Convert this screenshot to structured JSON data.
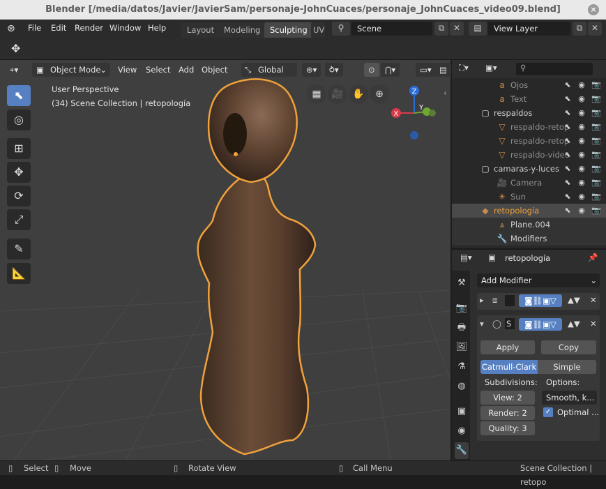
{
  "window": {
    "title": "Blender [/media/datos/Javier/JavierSam/personaje-JohnCuaces/personaje_JohnCuaces_video09.blend]",
    "close_glyph": "×"
  },
  "menubar": {
    "items": [
      "File",
      "Edit",
      "Render",
      "Window",
      "Help"
    ],
    "workspaces": [
      "Layout",
      "Modeling",
      "Sculpting",
      "UV"
    ],
    "active_workspace": "Sculpting",
    "scene": "Scene",
    "view_layer": "View Layer"
  },
  "viewport_header": {
    "mode": "Object Mode",
    "menus": [
      "View",
      "Select",
      "Add",
      "Object"
    ],
    "orientation": "Global"
  },
  "viewport": {
    "perspective": "User Perspective",
    "collection_info": "(34) Scene Collection | retopología",
    "gizmo": {
      "x": "X",
      "y": "Y",
      "z": "Z"
    }
  },
  "outliner": {
    "rows": [
      {
        "label": "Ojos",
        "icon": "font-icon",
        "level": 3,
        "dim": true
      },
      {
        "label": "Text",
        "icon": "font-icon",
        "level": 3,
        "dim": true
      },
      {
        "label": "respaldos",
        "icon": "collection-icon",
        "level": 2,
        "dim": false
      },
      {
        "label": "respaldo-retop",
        "icon": "mesh-cone-icon",
        "level": 3,
        "dim": true
      },
      {
        "label": "respaldo-retop",
        "icon": "mesh-cone-icon",
        "level": 3,
        "dim": true
      },
      {
        "label": "respaldo-video",
        "icon": "mesh-cone-icon",
        "level": 3,
        "dim": true
      },
      {
        "label": "camaras-y-luces",
        "icon": "collection-icon",
        "level": 2,
        "dim": false
      },
      {
        "label": "Camera",
        "icon": "camera-icon",
        "level": 3,
        "dim": true
      },
      {
        "label": "Sun",
        "icon": "light-icon",
        "level": 3,
        "dim": true
      },
      {
        "label": "retopología",
        "icon": "mesh-object-icon",
        "level": 2,
        "dim": false
      },
      {
        "label": "Plane.004",
        "icon": "vertex-mesh-icon",
        "level": 3,
        "dim": false
      },
      {
        "label": "Modifiers",
        "icon": "wrench-icon",
        "level": 3,
        "dim": false
      }
    ]
  },
  "properties": {
    "object_name": "retopología",
    "add_modifier": "Add Modifier",
    "mod2_letter": "S",
    "apply": "Apply",
    "copy": "Copy",
    "subsurf_types": [
      "Catmull-Clark",
      "Simple"
    ],
    "subdivisions_label": "Subdivisions:",
    "options_label": "Options:",
    "view": "View:",
    "view_value": "2",
    "render": "Render:",
    "render_value": "2",
    "quality": "Quality:",
    "quality_value": "3",
    "uv_option": "Smooth, k...",
    "optimal": "Optimal ..."
  },
  "statusbar": {
    "select": "Select",
    "move": "Move",
    "rotate": "Rotate View",
    "call_menu": "Call Menu",
    "scene_info": "Scene Collection | retopo"
  },
  "colors": {
    "accent": "#5680c2",
    "selection": "#f0a23b",
    "viewport_bg": "#3f3f3f"
  }
}
